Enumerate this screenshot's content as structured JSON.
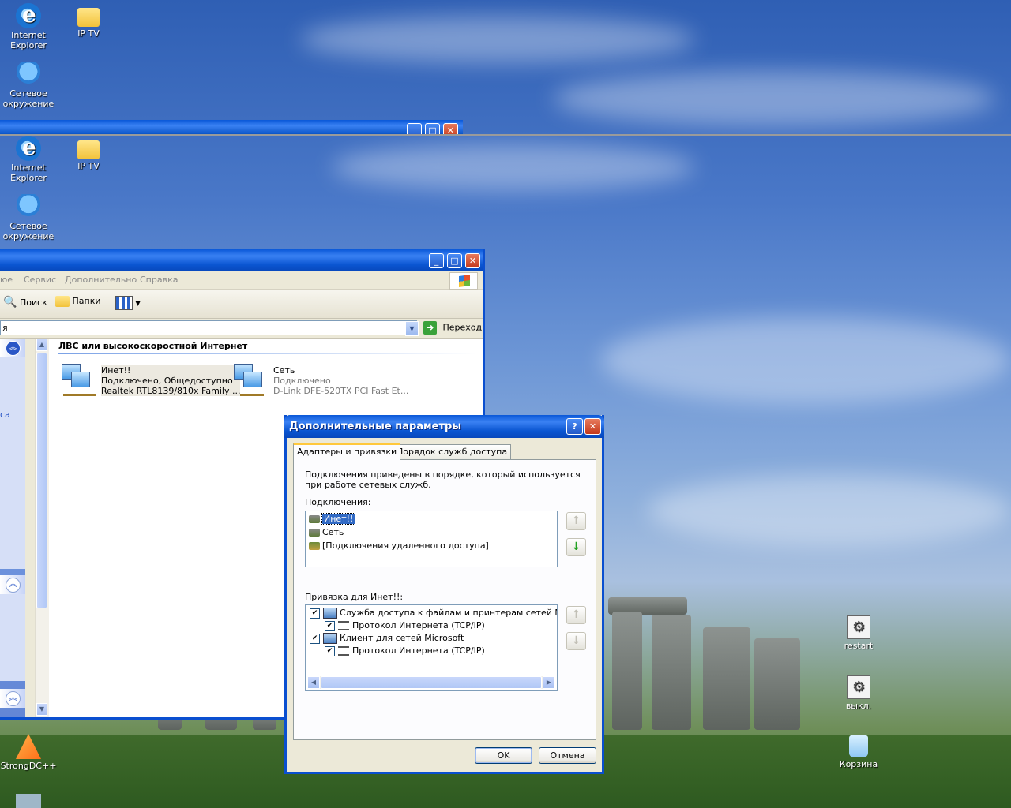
{
  "desktop": {
    "icons": [
      {
        "name": "internet-explorer",
        "label": "Internet Explorer"
      },
      {
        "name": "ip-tv",
        "label": "IP TV"
      },
      {
        "name": "network-places",
        "label": "Сетевое окружение"
      },
      {
        "name": "restart",
        "label": "restart"
      },
      {
        "name": "shutdown",
        "label": "выкл."
      },
      {
        "name": "recycle-bin",
        "label": "Корзина"
      },
      {
        "name": "strongdc",
        "label": "StrongDC++"
      }
    ]
  },
  "explorer": {
    "menu": [
      "юе",
      "Сервис",
      "Дополнительно",
      "Справка"
    ],
    "toolbar": {
      "search": "Поиск",
      "folders": "Папки"
    },
    "address": {
      "value": "я",
      "go": "Переход"
    },
    "left_pane_fragment": "са",
    "group_header": "ЛВС или высокоскоростной Интернет",
    "connections": [
      {
        "name": "Инет!!",
        "status": "Подключено, Общедоступно",
        "device": "Realtek RTL8139/810x Family ..."
      },
      {
        "name": "Сеть",
        "status": "Подключено",
        "device": "D-Link DFE-520TX PCI Fast Et..."
      }
    ]
  },
  "dialog": {
    "title": "Дополнительные параметры",
    "tabs": [
      "Адаптеры и привязки",
      "Порядок служб доступа"
    ],
    "description_line1": "Подключения приведены в порядке, который используется",
    "description_line2": "при работе сетевых служб.",
    "connections_label": "Подключения:",
    "connections": [
      "Инет!!",
      "Сеть",
      "[Подключения удаленного доступа]"
    ],
    "bindings_label": "Привязка для Инет!!:",
    "bindings": [
      {
        "label": "Служба доступа к файлам и принтерам сетей Microsoft",
        "level": 0
      },
      {
        "label": "Протокол Интернета (TCP/IP)",
        "level": 1
      },
      {
        "label": "Клиент для сетей Microsoft",
        "level": 0
      },
      {
        "label": "Протокол Интернета (TCP/IP)",
        "level": 1
      }
    ],
    "ok": "OK",
    "cancel": "Отмена",
    "help_glyph": "?",
    "close_glyph": "✕"
  },
  "colors": {
    "titlebar": "#0a58d8",
    "selection": "#316ac5",
    "accent_tab": "#ffc83c"
  }
}
